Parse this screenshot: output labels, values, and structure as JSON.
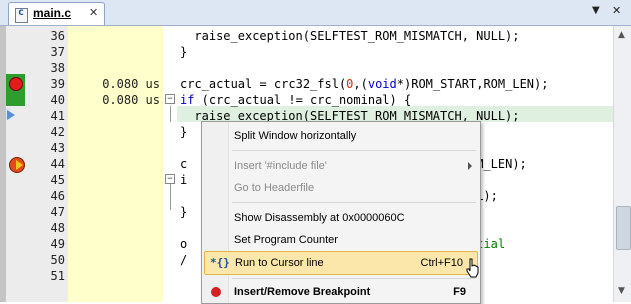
{
  "tab": {
    "title": "main.c",
    "close_glyph": "✕"
  },
  "toolbar": {
    "dropdown_glyph": "▼",
    "close_glyph": "✕"
  },
  "editor": {
    "lines": [
      {
        "num": "36",
        "time": "",
        "code": "raise_exception(SELFTEST_ROM_MISMATCH, NULL);",
        "indent": 4
      },
      {
        "num": "37",
        "time": "",
        "code": "}",
        "indent": 2
      },
      {
        "num": "38",
        "time": "",
        "code": "",
        "indent": 0
      },
      {
        "num": "39",
        "time": "0.080 us",
        "code": "crc_actual = crc32_fsl(0,(void*)ROM_START,ROM_LEN);",
        "indent": 2
      },
      {
        "num": "40",
        "time": "0.080 us",
        "code": "if (crc_actual != crc_nominal) {",
        "indent": 2
      },
      {
        "num": "41",
        "time": "",
        "code": "raise_exception(SELFTEST_ROM_MISMATCH, NULL);",
        "indent": 4
      },
      {
        "num": "42",
        "time": "",
        "code": "}",
        "indent": 2
      },
      {
        "num": "43",
        "time": "",
        "code": "",
        "indent": 0
      },
      {
        "num": "44",
        "time": "",
        "code": "c                               _START,ROM_LEN);",
        "indent": 2
      },
      {
        "num": "45",
        "time": "",
        "code": "i",
        "indent": 2
      },
      {
        "num": "46",
        "time": "",
        "code": "                                ATCH, NULL);",
        "indent": 2
      },
      {
        "num": "47",
        "time": "",
        "code": "}",
        "indent": 2
      },
      {
        "num": "48",
        "time": "",
        "code": "",
        "indent": 0
      },
      {
        "num": "49",
        "time": "",
        "code": "o                                  // initial",
        "indent": 2
      },
      {
        "num": "50",
        "time": "",
        "code": "/",
        "indent": 2
      },
      {
        "num": "51",
        "time": "",
        "code": "",
        "indent": 0
      }
    ]
  },
  "context_menu": {
    "items": [
      {
        "label": "Split Window horizontally",
        "shortcut": "",
        "disabled": false
      },
      {
        "label": "Insert '#include file'",
        "shortcut": "",
        "disabled": true,
        "submenu": true
      },
      {
        "label": "Go to Headerfile",
        "shortcut": "",
        "disabled": true
      },
      {
        "label": "Show Disassembly at 0x0000060C",
        "shortcut": "",
        "disabled": false
      },
      {
        "label": "Set Program Counter",
        "shortcut": "",
        "disabled": false
      },
      {
        "label": "Run to Cursor line",
        "shortcut": "Ctrl+F10",
        "disabled": false,
        "icon_text": "*{}"
      },
      {
        "label": "Insert/Remove Breakpoint",
        "shortcut": "F9",
        "disabled": false
      }
    ]
  },
  "colors": {
    "timing_column": "#ffffcc",
    "breakpoint_active": "#2d9d2d",
    "menu_hover": "#fbe7a9"
  }
}
